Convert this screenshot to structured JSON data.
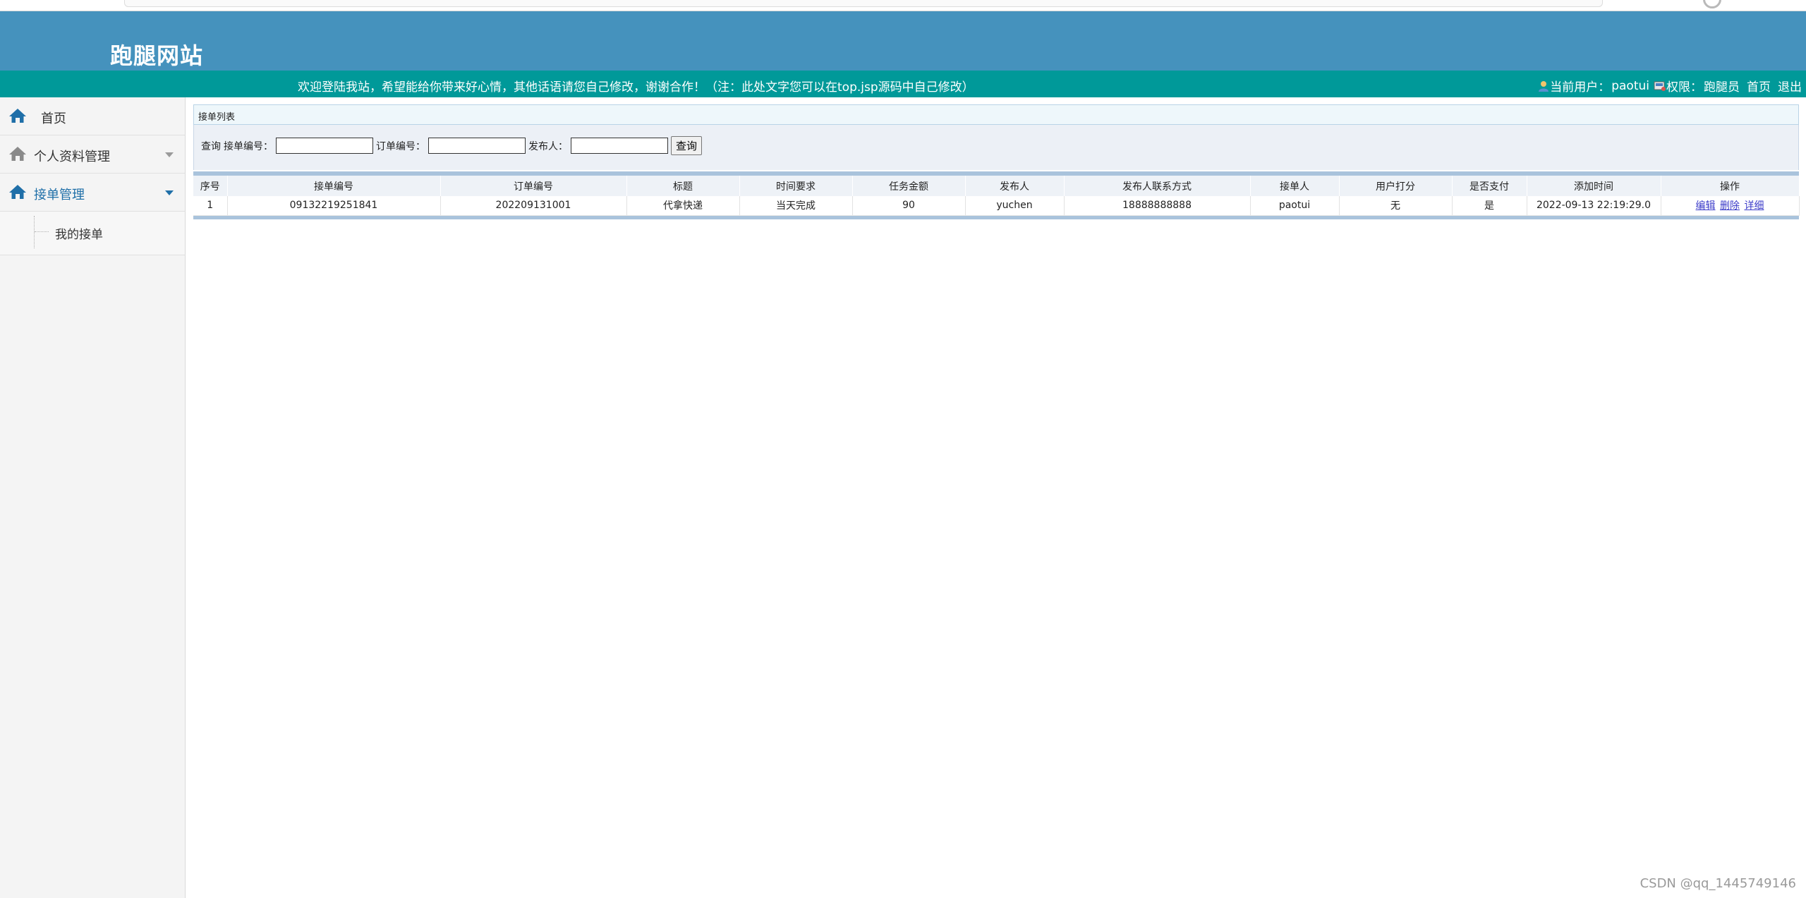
{
  "header": {
    "site_title": "跑腿网站"
  },
  "info_bar": {
    "welcome": "欢迎登陆我站，希望能给你带来好心情，其他话语请您自己修改，谢谢合作！（注：此处文字您可以在top.jsp源码中自己修改）",
    "current_user_label": "当前用户：",
    "current_user": "paotui",
    "role_label": "权限：",
    "role": "跑腿员",
    "home_link": "首页",
    "logout_link": "退出"
  },
  "sidebar": {
    "home": "首页",
    "profile": "个人资料管理",
    "orders": "接单管理",
    "my_orders": "我的接单"
  },
  "panel": {
    "title": "接单列表",
    "query_label": "查询",
    "field_order_no": "接单编号：",
    "field_ref_no": "订单编号：",
    "field_publisher": "发布人：",
    "query_button": "查询"
  },
  "table": {
    "headers": [
      "序号",
      "接单编号",
      "订单编号",
      "标题",
      "时间要求",
      "任务金额",
      "发布人",
      "发布人联系方式",
      "接单人",
      "用户打分",
      "是否支付",
      "添加时间",
      "操作"
    ],
    "rows": [
      {
        "index": "1",
        "order_no": "09132219251841",
        "ref_no": "202209131001",
        "title": "代拿快递",
        "time_req": "当天完成",
        "amount": "90",
        "publisher": "yuchen",
        "contact": "18888888888",
        "taker": "paotui",
        "rating": "无",
        "paid": "是",
        "added": "2022-09-13 22:19:29.0",
        "op_edit": "编辑",
        "op_delete": "删除",
        "op_detail": "详细"
      }
    ]
  },
  "watermark": "CSDN @qq_1445749146",
  "colors": {
    "header": "#4592bd",
    "info_bar": "#009999",
    "sidebar_active": "#1f6fa8"
  }
}
